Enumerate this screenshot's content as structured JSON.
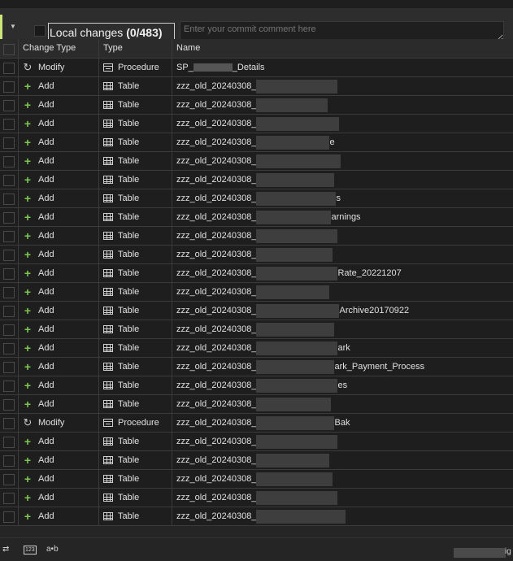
{
  "header": {
    "toggle_icon": "dropdown-caret-icon",
    "local_changes_prefix": "Local changes ",
    "local_changes_count": "(0/483)",
    "commit_placeholder": "Enter your commit comment here"
  },
  "columns": {
    "change_type": "Change Type",
    "type": "Type",
    "name": "Name"
  },
  "rows": [
    {
      "change": "Modify",
      "type": "Procedure",
      "name_a": "SP_",
      "name_b": "_Details",
      "kind": "proc"
    },
    {
      "change": "Add",
      "type": "Table",
      "name_a": "zzz_old_20240308_",
      "name_b": "",
      "kind": "table"
    },
    {
      "change": "Add",
      "type": "Table",
      "name_a": "zzz_old_20240308_",
      "name_b": "",
      "kind": "table"
    },
    {
      "change": "Add",
      "type": "Table",
      "name_a": "zzz_old_20240308_",
      "name_b": "",
      "kind": "table"
    },
    {
      "change": "Add",
      "type": "Table",
      "name_a": "zzz_old_20240308_",
      "name_b": "e",
      "kind": "table"
    },
    {
      "change": "Add",
      "type": "Table",
      "name_a": "zzz_old_20240308_",
      "name_b": "",
      "kind": "table"
    },
    {
      "change": "Add",
      "type": "Table",
      "name_a": "zzz_old_20240308_",
      "name_b": "",
      "kind": "table"
    },
    {
      "change": "Add",
      "type": "Table",
      "name_a": "zzz_old_20240308_",
      "name_b": "s",
      "kind": "table"
    },
    {
      "change": "Add",
      "type": "Table",
      "name_a": "zzz_old_20240308_",
      "name_b": "arnings",
      "kind": "table"
    },
    {
      "change": "Add",
      "type": "Table",
      "name_a": "zzz_old_20240308_",
      "name_b": "",
      "kind": "table"
    },
    {
      "change": "Add",
      "type": "Table",
      "name_a": "zzz_old_20240308_",
      "name_b": "",
      "kind": "table"
    },
    {
      "change": "Add",
      "type": "Table",
      "name_a": "zzz_old_20240308_",
      "name_b": "Rate_20221207",
      "kind": "table"
    },
    {
      "change": "Add",
      "type": "Table",
      "name_a": "zzz_old_20240308_",
      "name_b": "",
      "kind": "table"
    },
    {
      "change": "Add",
      "type": "Table",
      "name_a": "zzz_old_20240308_",
      "name_b": "Archive20170922",
      "kind": "table"
    },
    {
      "change": "Add",
      "type": "Table",
      "name_a": "zzz_old_20240308_",
      "name_b": "",
      "kind": "table"
    },
    {
      "change": "Add",
      "type": "Table",
      "name_a": "zzz_old_20240308_",
      "name_b": "ark",
      "kind": "table"
    },
    {
      "change": "Add",
      "type": "Table",
      "name_a": "zzz_old_20240308_",
      "name_b": "ark_Payment_Process",
      "kind": "table"
    },
    {
      "change": "Add",
      "type": "Table",
      "name_a": "zzz_old_20240308_",
      "name_b": "es",
      "kind": "table"
    },
    {
      "change": "Add",
      "type": "Table",
      "name_a": "zzz_old_20240308_",
      "name_b": "",
      "kind": "table"
    },
    {
      "change": "Modify",
      "type": "Procedure",
      "name_a": "zzz_old_20240308_",
      "name_b": "Bak",
      "kind": "table"
    },
    {
      "change": "Add",
      "type": "Table",
      "name_a": "zzz_old_20240308_",
      "name_b": "",
      "kind": "table"
    },
    {
      "change": "Add",
      "type": "Table",
      "name_a": "zzz_old_20240308_",
      "name_b": "",
      "kind": "table"
    },
    {
      "change": "Add",
      "type": "Table",
      "name_a": "zzz_old_20240308_",
      "name_b": "",
      "kind": "table"
    },
    {
      "change": "Add",
      "type": "Table",
      "name_a": "zzz_old_20240308_",
      "name_b": "",
      "kind": "table"
    },
    {
      "change": "Add",
      "type": "Table",
      "name_a": "zzz_old_20240308_",
      "name_b": "",
      "kind": "table"
    }
  ],
  "statusbar": {
    "ab_label": "a•b",
    "num_label": "123",
    "right_text": "ig"
  },
  "colors": {
    "accent": "#cde67a",
    "add_icon": "#7ec850",
    "background": "#1e1e1e"
  }
}
